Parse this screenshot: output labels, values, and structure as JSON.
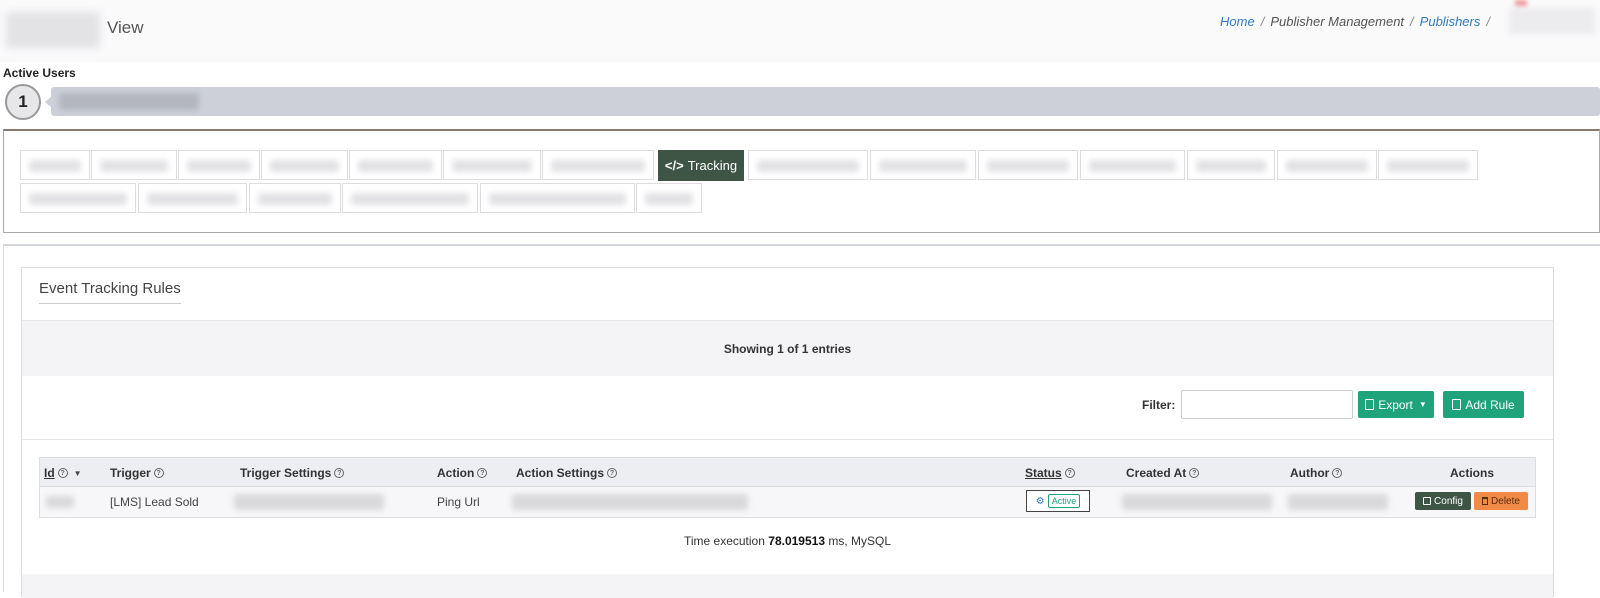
{
  "header": {
    "title": "View",
    "breadcrumb": [
      {
        "label": "Home",
        "link": true
      },
      {
        "label": "Publisher Management",
        "link": false
      },
      {
        "label": "Publishers",
        "link": true
      }
    ]
  },
  "active_users": {
    "label": "Active Users",
    "count": "1"
  },
  "tabs": {
    "active_label": "Tracking",
    "active_icon": "code-icon"
  },
  "card": {
    "title": "Event Tracking Rules",
    "showing": "Showing 1 of 1 entries",
    "filter_label": "Filter:",
    "filter_value": "",
    "export_label": "Export",
    "add_rule_label": "Add Rule"
  },
  "table": {
    "columns": [
      {
        "label": "Id",
        "underline": true
      },
      {
        "label": "Trigger"
      },
      {
        "label": "Trigger Settings"
      },
      {
        "label": "Action"
      },
      {
        "label": "Action Settings"
      },
      {
        "label": "Status",
        "underline": true
      },
      {
        "label": "Created At"
      },
      {
        "label": "Author"
      },
      {
        "label": "Actions"
      }
    ],
    "rows": [
      {
        "trigger": "[LMS] Lead Sold",
        "action": "Ping Url",
        "status": "Active",
        "config_label": "Config",
        "delete_label": "Delete"
      }
    ]
  },
  "footer": {
    "time_prefix": "Time execution",
    "time_value": "78.019513",
    "time_suffix": "ms, MySQL"
  },
  "colors": {
    "accent_green": "#1ea37a",
    "dark_green": "#3e5545",
    "link_blue": "#2e7bc4",
    "delete_orange": "#f08a46"
  }
}
